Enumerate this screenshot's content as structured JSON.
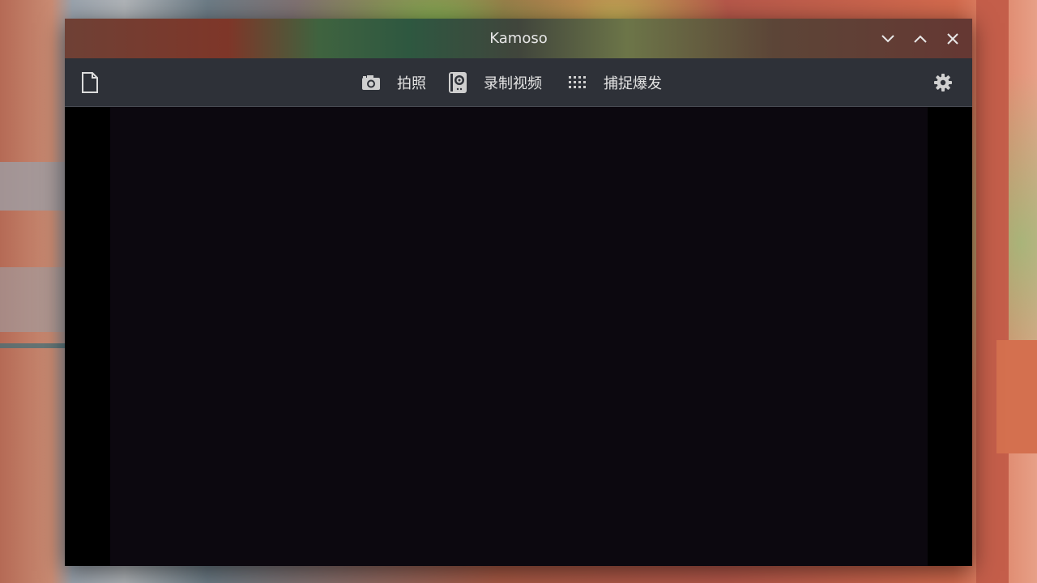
{
  "window": {
    "title": "Kamoso",
    "controls": {
      "minimize_icon": "chevron-down-icon",
      "maximize_icon": "chevron-up-icon",
      "close_icon": "close-icon"
    }
  },
  "toolbar": {
    "left_icon": "document-icon",
    "actions": [
      {
        "icon": "camera-icon",
        "label": "拍照"
      },
      {
        "icon": "video-camera-icon",
        "label": "录制视频"
      },
      {
        "icon": "grid-dots-icon",
        "label": "捕捉爆发"
      }
    ],
    "settings_icon": "gear-icon"
  },
  "colors": {
    "toolbar_bg": "#2e3138",
    "preview_bg": "#0c080f",
    "text": "#e4e4e4"
  }
}
